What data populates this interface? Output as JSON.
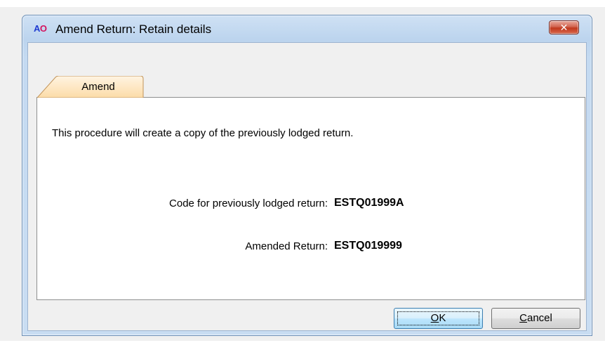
{
  "window": {
    "app_icon_a": "A",
    "app_icon_o": "O",
    "title": "Amend Return: Retain details",
    "close_symbol": "✕"
  },
  "tabs": [
    {
      "label": "Amend",
      "active": true
    }
  ],
  "panel": {
    "intro_text": "This procedure will create a copy of the previously lodged return.",
    "fields": [
      {
        "label": "Code for previously lodged return:",
        "value": "ESTQ01999A"
      },
      {
        "label": "Amended Return:",
        "value": "ESTQ019999"
      }
    ]
  },
  "buttons": {
    "ok": {
      "mnemonic": "O",
      "rest": "K"
    },
    "cancel": {
      "mnemonic": "C",
      "rest": "ancel"
    }
  },
  "colors": {
    "window_frame": "#bcd4ee",
    "tab_fill": "#fde7c4",
    "close_button": "#c1381d",
    "app_icon_a": "#1f3bd1",
    "app_icon_o": "#d3125d"
  }
}
